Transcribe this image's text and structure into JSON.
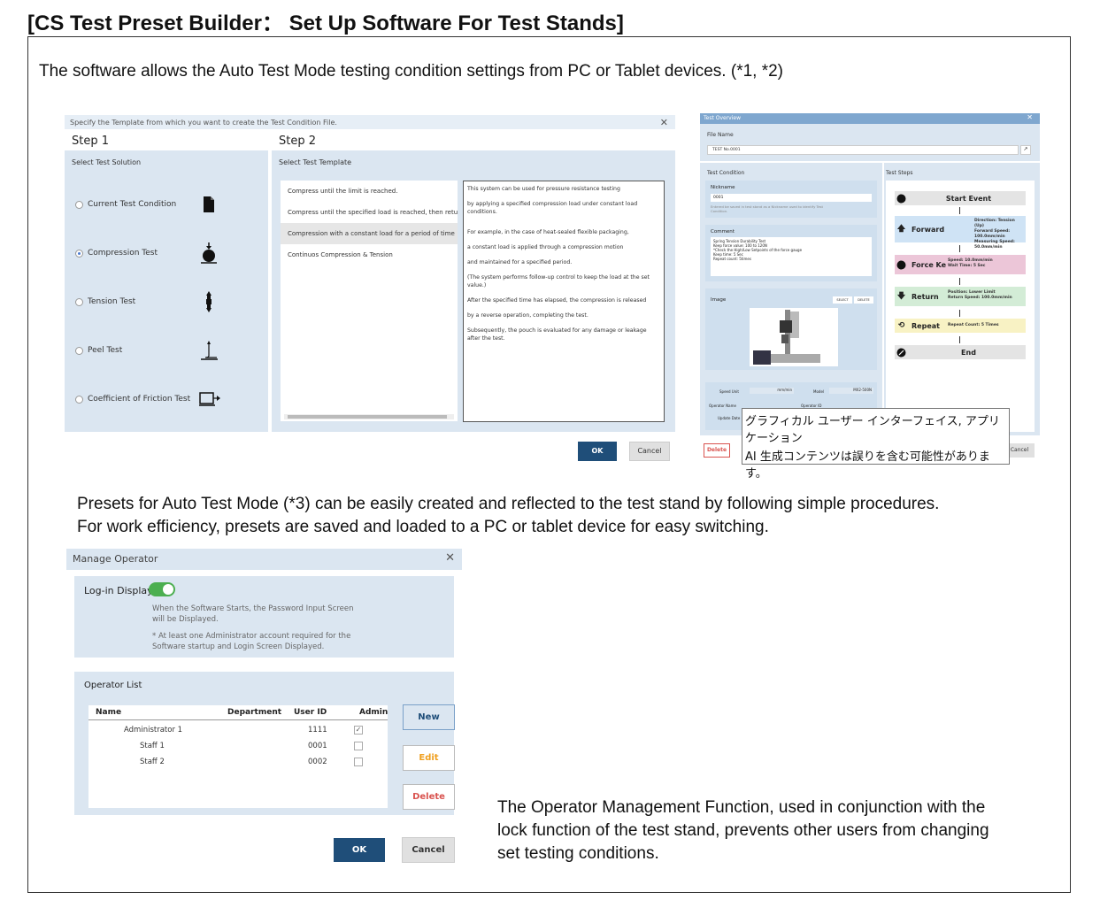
{
  "page": {
    "title": "[CS Test Preset Builder： Set Up Software For Test Stands]",
    "intro": "The software allows the Auto Test Mode testing condition settings from PC or Tablet devices. (*1, *2)",
    "para2_line1": "Presets for Auto Test Mode (*3) can be easily created and reflected to the test stand by following simple procedures.",
    "para2_line2": "For work efficiency, presets are saved and loaded to a PC or tablet device for easy switching.",
    "para3_line1": "The Operator Management Function, used in conjunction with the",
    "para3_line2": "lock function of the test stand, prevents other users from changing",
    "para3_line3": "set testing conditions."
  },
  "template_dialog": {
    "title": "Specify the Template from which you want to create the Test Condition File.",
    "step1": "Step 1",
    "step2": "Step 2",
    "select_solution": "Select Test Solution",
    "select_template": "Select Test Template",
    "solutions": [
      {
        "label": "Current Test Condition",
        "icon": "document-icon",
        "selected": false
      },
      {
        "label": "Compression Test",
        "icon": "compression-icon",
        "selected": true
      },
      {
        "label": "Tension Test",
        "icon": "tension-icon",
        "selected": false
      },
      {
        "label": "Peel Test",
        "icon": "peel-icon",
        "selected": false
      },
      {
        "label": "Coefficient of Friction Test",
        "icon": "friction-icon",
        "selected": false
      }
    ],
    "templates": [
      "Compress until the limit is reached.",
      "Compress until the specified load is reached, then retu",
      "Compression with a constant load for a period of time",
      "Continuos Compression & Tension"
    ],
    "description": [
      "This system can be used for pressure resistance testing",
      "by applying a specified compression load under constant load conditions.",
      "For example, in the case of heat-sealed flexible packaging,",
      "a constant load is applied through a compression motion",
      "and maintained for a specified period.",
      "(The system performs follow-up control to keep the load at the set value.)",
      "After the specified time has elapsed, the compression is released",
      "by a reverse operation, completing the test.",
      "Subsequently, the pouch is evaluated for any damage or leakage after the test."
    ],
    "ok": "OK",
    "cancel": "Cancel"
  },
  "overview_dialog": {
    "title": "Test Overview",
    "file_name_label": "File Name",
    "file_name": "TEST No.0001",
    "test_condition": "Test Condition",
    "nickname_label": "Nickname",
    "nickname": "0001",
    "nickname_hint": "Entered be saved in test stand as a Nickname used to identify Test Condition.",
    "comment_label": "Comment",
    "comment_lines": [
      "Spring Tension Durability Test",
      "Keep force value: 100 to 120N",
      "*Check the High/Low Setpoints of the force gauge",
      "Keep time: 5 Sec",
      "Repeat count: 5times"
    ],
    "image_label": "Image",
    "select": "SELECT",
    "delete_small": "DELETE",
    "speed_unit_label": "Speed Unit",
    "speed_unit": "mm/min",
    "model_label": "Model",
    "model": "MX2-500N",
    "operator_name_label": "Operator Name",
    "operator_id_label": "Operator ID",
    "update_label": "Update Date",
    "test_steps": "Test Steps",
    "steps": [
      {
        "name": "Start Event",
        "icon": "start-icon",
        "detail": [],
        "color": "#e4e4e4"
      },
      {
        "name": "Forward",
        "icon": "arrow-up-icon",
        "detail": [
          "Direction: Tension (Up)",
          "Forward Speed: 100.0mm/min",
          "Measuring Speed: 50.0mm/min"
        ],
        "color": "#cfe3f5"
      },
      {
        "name": "Force Ke",
        "icon": "force-keep-icon",
        "detail": [
          "Speed: 10.0mm/min",
          "Wait Time: 5 Sec"
        ],
        "color": "#ecc6d8"
      },
      {
        "name": "Return",
        "icon": "arrow-down-icon",
        "detail": [
          "Position: Lower Limit",
          "Return Speed: 100.0mm/min"
        ],
        "color": "#d3ecd6"
      },
      {
        "name": "Repeat",
        "icon": "repeat-icon",
        "detail": [
          "Repeat Count: 5 Times"
        ],
        "color": "#f8f2c4"
      },
      {
        "name": "End",
        "icon": "end-icon",
        "detail": [],
        "color": "#e4e4e4"
      }
    ],
    "delete": "Delete",
    "cancel": "Cancel"
  },
  "tooltip": {
    "line1": "グラフィカル ユーザー インターフェイス, アプリケーション",
    "line2": "AI 生成コンテンツは誤りを含む可能性があります。"
  },
  "operator_dialog": {
    "title": "Manage Operator",
    "login_display": "Log-in Display",
    "login_enabled": true,
    "note1_line1": "When the Software Starts, the Password Input Screen",
    "note1_line2": "will be Displayed.",
    "note2_line1": "* At least one Administrator account required for the",
    "note2_line2": "Software startup and Login Screen Displayed.",
    "operator_list": "Operator List",
    "columns": {
      "name": "Name",
      "department": "Department",
      "user_id": "User ID",
      "admin": "Admin"
    },
    "rows": [
      {
        "name": "Administrator 1",
        "department": "",
        "user_id": "1111",
        "admin": true
      },
      {
        "name": "Staff 1",
        "department": "",
        "user_id": "0001",
        "admin": false
      },
      {
        "name": "Staff 2",
        "department": "",
        "user_id": "0002",
        "admin": false
      }
    ],
    "new": "New",
    "edit": "Edit",
    "delete": "Delete",
    "ok": "OK",
    "cancel": "Cancel"
  },
  "colors": {
    "accent_dark": "#1f4e79",
    "panel": "#dbe6f1",
    "toggle_on": "#4caf50",
    "edit_orange": "#f0a020",
    "delete_red": "#d9534f"
  }
}
